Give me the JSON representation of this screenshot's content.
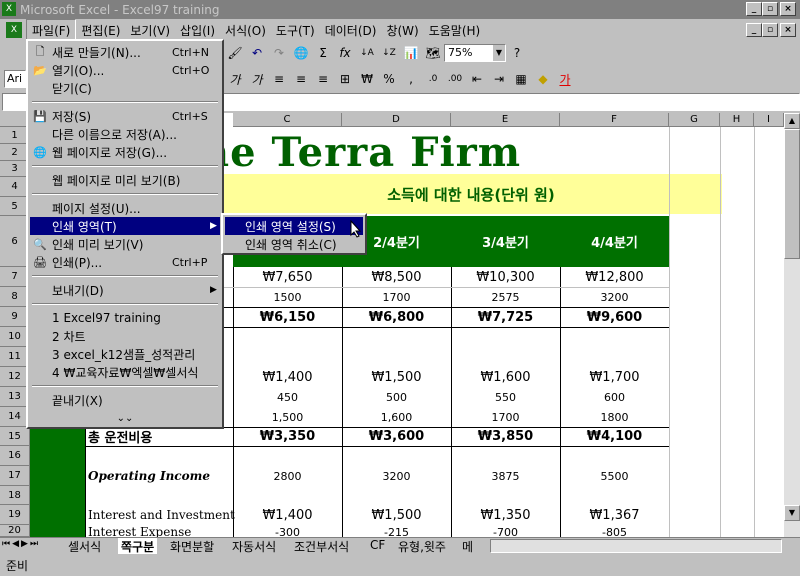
{
  "window": {
    "title": "Microsoft Excel - Excel97 training"
  },
  "menubar": [
    "파일(F)",
    "편집(E)",
    "보기(V)",
    "삽입(I)",
    "서식(O)",
    "도구(T)",
    "데이터(D)",
    "창(W)",
    "도움말(H)"
  ],
  "toolbar": {
    "zoom": "75%",
    "font_name": "Ari"
  },
  "columns": [
    "C",
    "D",
    "E",
    "F",
    "G",
    "H",
    "I"
  ],
  "rows": [
    "1",
    "2",
    "3",
    "4",
    "5",
    "6",
    "7",
    "8",
    "9",
    "10",
    "11",
    "12",
    "13",
    "14",
    "15",
    "16",
    "17",
    "18",
    "19",
    "20"
  ],
  "sheet": {
    "title": "he Terra Firm",
    "subtitle": "소득에 대한 내용(단위 원)",
    "quarters": [
      "2/4분기",
      "3/4분기",
      "4/4분기"
    ],
    "r7": [
      "₩7,650",
      "₩8,500",
      "₩10,300",
      "₩12,800"
    ],
    "r8": [
      "1500",
      "1700",
      "2575",
      "3200"
    ],
    "r9": [
      "₩6,150",
      "₩6,800",
      "₩7,725",
      "₩9,600"
    ],
    "r12": [
      "₩1,400",
      "₩1,500",
      "₩1,600",
      "₩1,700"
    ],
    "r13": [
      "450",
      "500",
      "550",
      "600"
    ],
    "r14": [
      "1,500",
      "1,600",
      "1700",
      "1800"
    ],
    "r15_label": "총 운전비용",
    "r15": [
      "₩3,350",
      "₩3,600",
      "₩3,850",
      "₩4,100"
    ],
    "r17_label": "Operating Income",
    "r17": [
      "2800",
      "3200",
      "3875",
      "5500"
    ],
    "r19_label": "Interest and Investment",
    "r19": [
      "₩1,400",
      "₩1,500",
      "₩1,350",
      "₩1,367"
    ],
    "r20_label": "Interest Expense",
    "r20": [
      "-300",
      "-215",
      "-700",
      "-805"
    ]
  },
  "file_menu": {
    "new": "새로 만들기(N)...",
    "new_sc": "Ctrl+N",
    "open": "열기(O)...",
    "open_sc": "Ctrl+O",
    "close": "닫기(C)",
    "save": "저장(S)",
    "save_sc": "Ctrl+S",
    "saveas": "다른 이름으로 저장(A)...",
    "saveweb": "웹 페이지로 저장(G)...",
    "webpreview": "웹 페이지로 미리 보기(B)",
    "pagesetup": "페이지 설정(U)...",
    "printarea": "인쇄 영역(T)",
    "printpreview": "인쇄 미리 보기(V)",
    "print": "인쇄(P)...",
    "print_sc": "Ctrl+P",
    "send": "보내기(D)",
    "recent": [
      "1 Excel97 training",
      "2 차트",
      "3 excel_k12샘플_성적관리",
      "4 ₩교육자료₩엑셀₩셀서식"
    ],
    "exit": "끝내기(X)"
  },
  "submenu": {
    "set": "인쇄 영역 설정(S)",
    "clear": "인쇄 영역 취소(C)"
  },
  "sheet_tabs": [
    "셀서식",
    "쪽구분",
    "화면분할",
    "자동서식",
    "조건부서식",
    "CF",
    "유형,윗주",
    "메"
  ],
  "status": "준비",
  "colors": {
    "green": "#007000",
    "banner": "#ffff99",
    "menu_highlight": "#000080"
  }
}
